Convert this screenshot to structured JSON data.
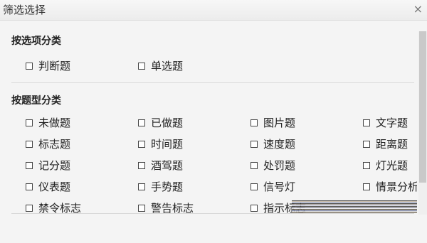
{
  "window": {
    "title": "筛选选择",
    "close_glyph": "×"
  },
  "sections": [
    {
      "title": "按选项分类",
      "options": [
        "判断题",
        "单选题"
      ]
    },
    {
      "title": "按题型分类",
      "options": [
        "未做题",
        "已做题",
        "图片题",
        "文字题",
        "标志题",
        "时间题",
        "速度题",
        "距离题",
        "记分题",
        "酒驾题",
        "处罚题",
        "灯光题",
        "仪表题",
        "手势题",
        "信号灯",
        "情景分析",
        "禁令标志",
        "警告标志",
        "指示标志"
      ]
    }
  ],
  "icons": {
    "checkbox": "checkbox-icon",
    "close": "close-icon"
  }
}
